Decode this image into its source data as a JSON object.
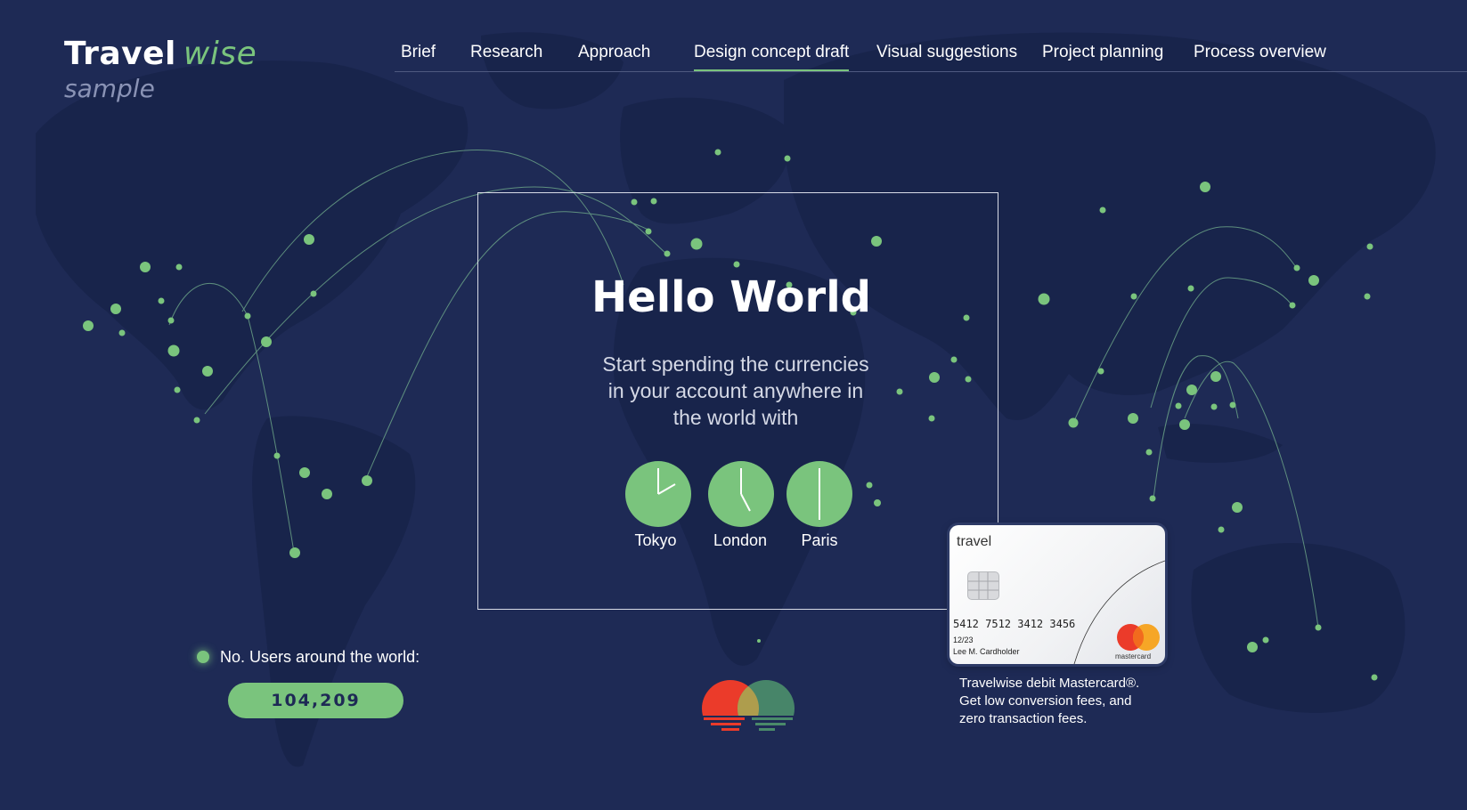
{
  "logo": {
    "main": "Travel",
    "accent": "wise",
    "sub": "sample"
  },
  "nav": {
    "items": [
      {
        "label": "Brief"
      },
      {
        "label": "Research"
      },
      {
        "label": "Approach"
      },
      {
        "label": "Design concept draft",
        "active": true
      },
      {
        "label": "Visual suggestions"
      },
      {
        "label": "Project planning"
      },
      {
        "label": "Process overview"
      }
    ]
  },
  "hero": {
    "title": "Hello World",
    "subtitle_lines": [
      "Start spending the currencies",
      "in your account anywhere in",
      "the world with"
    ]
  },
  "clocks": [
    {
      "city": "Tokyo"
    },
    {
      "city": "London"
    },
    {
      "city": "Paris"
    }
  ],
  "users": {
    "label": "No. Users around the world:",
    "count": "104,209"
  },
  "card": {
    "brand": "travel",
    "number": "5412 7512 3412 3456",
    "expiry": "12/23",
    "holder": "Lee M. Cardholder",
    "network": "mastercard"
  },
  "card_caption": [
    "Travelwise debit Mastercard®.",
    "Get low conversion fees, and",
    "zero transaction fees."
  ],
  "colors": {
    "background": "#1e2a55",
    "accent": "#7ac47d",
    "land": "#1a2447",
    "mc_red": "#eb3b2a",
    "mc_orange": "#f7a21b"
  },
  "icons": {
    "map": "world-map-icon",
    "clock": "clock-icon",
    "chip": "chip-icon",
    "mastercard": "mastercard-icon"
  }
}
